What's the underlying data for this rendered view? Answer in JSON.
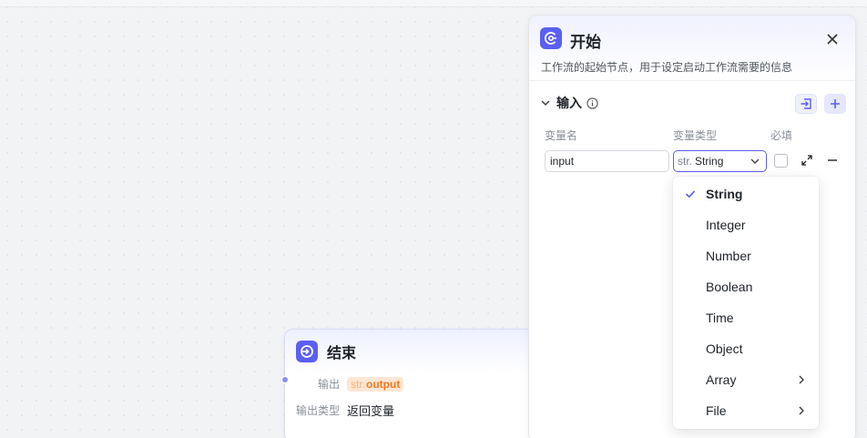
{
  "end_node": {
    "title": "结束",
    "output_label": "输出",
    "output_var_prefix": "str.",
    "output_var_name": "output",
    "output_type_label": "输出类型",
    "output_type_value": "返回变量"
  },
  "panel": {
    "title": "开始",
    "description": "工作流的起始节点，用于设定启动工作流需要的信息",
    "section_title": "输入",
    "columns": {
      "name": "变量名",
      "type": "变量类型",
      "required": "必填"
    },
    "row": {
      "name_value": "input",
      "type_prefix": "str.",
      "type_value": "String",
      "required": false
    }
  },
  "type_dropdown": {
    "selected": "String",
    "options": [
      {
        "label": "String",
        "has_submenu": false
      },
      {
        "label": "Integer",
        "has_submenu": false
      },
      {
        "label": "Number",
        "has_submenu": false
      },
      {
        "label": "Boolean",
        "has_submenu": false
      },
      {
        "label": "Time",
        "has_submenu": false
      },
      {
        "label": "Object",
        "has_submenu": false
      },
      {
        "label": "Array",
        "has_submenu": true
      },
      {
        "label": "File",
        "has_submenu": true
      }
    ]
  },
  "colors": {
    "accent": "#5b5ff2",
    "output_tag_bg": "#fde7d4",
    "output_tag_text": "#f2781d"
  },
  "icons": {
    "end_node": "end-node-icon",
    "start_node": "start-node-icon",
    "close": "close-icon",
    "collapse": "chevron-down-icon",
    "info": "info-icon",
    "import": "import-icon",
    "add": "plus-icon",
    "expand": "expand-icon",
    "remove": "minus-icon",
    "check": "check-icon",
    "submenu": "chevron-right-icon"
  }
}
